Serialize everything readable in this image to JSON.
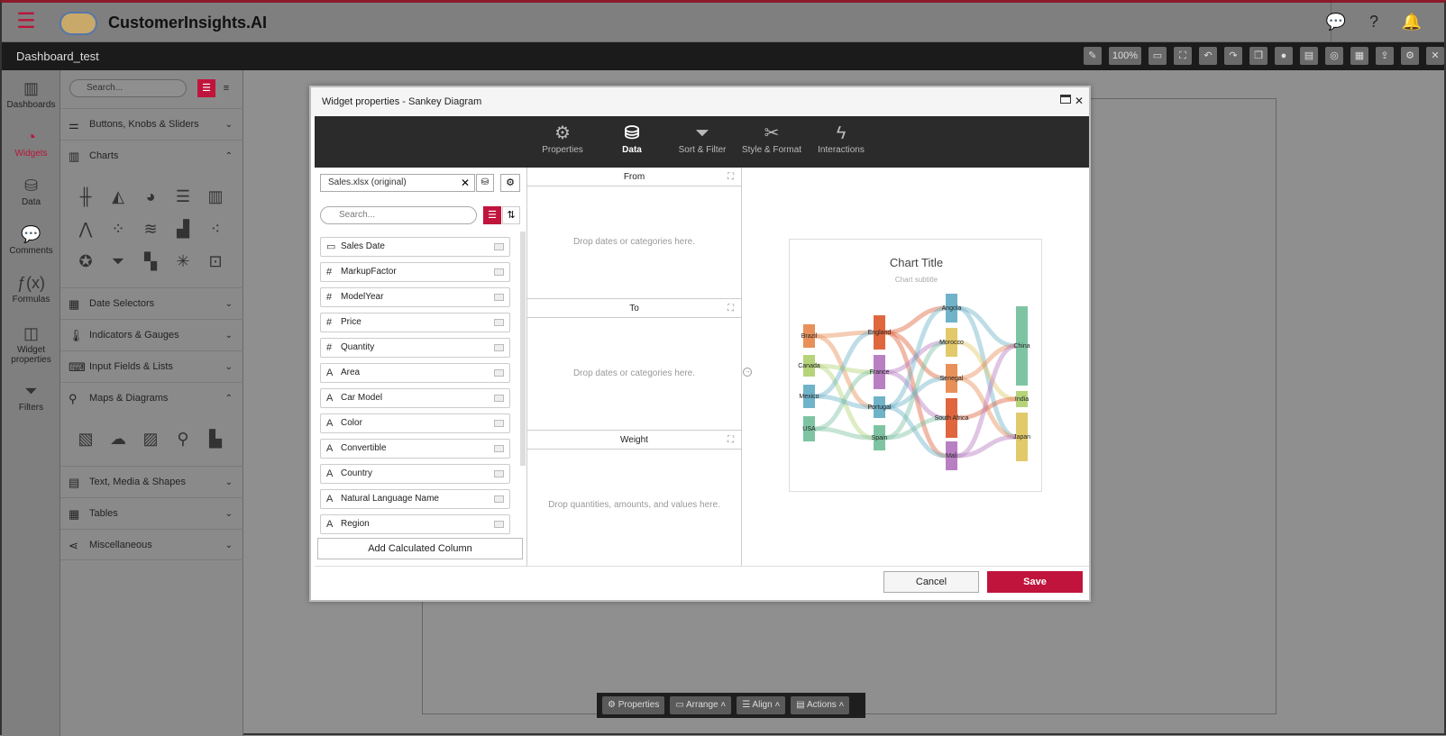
{
  "app": {
    "title": "CustomerInsights.AI",
    "dashboard_name": "Dashboard_test",
    "zoom": "100%"
  },
  "left_nav": [
    {
      "label": "Dashboards",
      "icon": "bar-chart-icon"
    },
    {
      "label": "Widgets",
      "icon": "gauge-icon",
      "active": true
    },
    {
      "label": "Data",
      "icon": "database-icon"
    },
    {
      "label": "Comments",
      "icon": "comment-icon"
    },
    {
      "label": "Formulas",
      "icon": "fx-icon"
    },
    {
      "label": "Widget properties",
      "icon": "widget-icon"
    },
    {
      "label": "Filters",
      "icon": "filter-icon"
    }
  ],
  "widget_panel": {
    "search_placeholder": "Search...",
    "categories": [
      "Buttons, Knobs & Sliders",
      "Charts",
      "Date Selectors",
      "Indicators & Gauges",
      "Input Fields & Lists",
      "Maps & Diagrams",
      "Text, Media & Shapes",
      "Tables",
      "Miscellaneous"
    ]
  },
  "modal": {
    "title": "Widget properties - Sankey Diagram",
    "tabs": [
      {
        "label": "Properties",
        "icon": "gears-icon"
      },
      {
        "label": "Data",
        "icon": "database-icon",
        "active": true
      },
      {
        "label": "Sort & Filter",
        "icon": "filter-icon"
      },
      {
        "label": "Style & Format",
        "icon": "style-icon"
      },
      {
        "label": "Interactions",
        "icon": "lightning-icon"
      }
    ],
    "datasource": "Sales.xlsx (original)",
    "field_search_placeholder": "Search...",
    "fields": [
      {
        "type": "date",
        "name": "Sales Date"
      },
      {
        "type": "#",
        "name": "MarkupFactor"
      },
      {
        "type": "#",
        "name": "ModelYear"
      },
      {
        "type": "#",
        "name": "Price"
      },
      {
        "type": "#",
        "name": "Quantity"
      },
      {
        "type": "A",
        "name": "Area"
      },
      {
        "type": "A",
        "name": "Car Model"
      },
      {
        "type": "A",
        "name": "Color"
      },
      {
        "type": "A",
        "name": "Convertible"
      },
      {
        "type": "A",
        "name": "Country"
      },
      {
        "type": "A",
        "name": "Natural Language Name"
      },
      {
        "type": "A",
        "name": "Region"
      }
    ],
    "add_calculated": "Add Calculated Column",
    "drops": [
      {
        "header": "From",
        "hint": "Drop dates or categories here."
      },
      {
        "header": "To",
        "hint": "Drop dates or categories here."
      },
      {
        "header": "Weight",
        "hint": "Drop quantities, amounts, and values here."
      }
    ],
    "preview": {
      "title": "Chart Title",
      "subtitle": "Chart subtitle"
    },
    "cancel": "Cancel",
    "save": "Save"
  },
  "sankey": {
    "col1": [
      "Brazil",
      "Canada",
      "Mexico",
      "USA"
    ],
    "col2": [
      "England",
      "France",
      "Portugal",
      "Spain"
    ],
    "col3": [
      "Angola",
      "Morocco",
      "Senegal",
      "South Africa",
      "Mali"
    ],
    "col4": [
      "China",
      "India",
      "Japan"
    ]
  },
  "bottom_bar": [
    "Properties",
    "Arrange",
    "Align",
    "Actions"
  ]
}
